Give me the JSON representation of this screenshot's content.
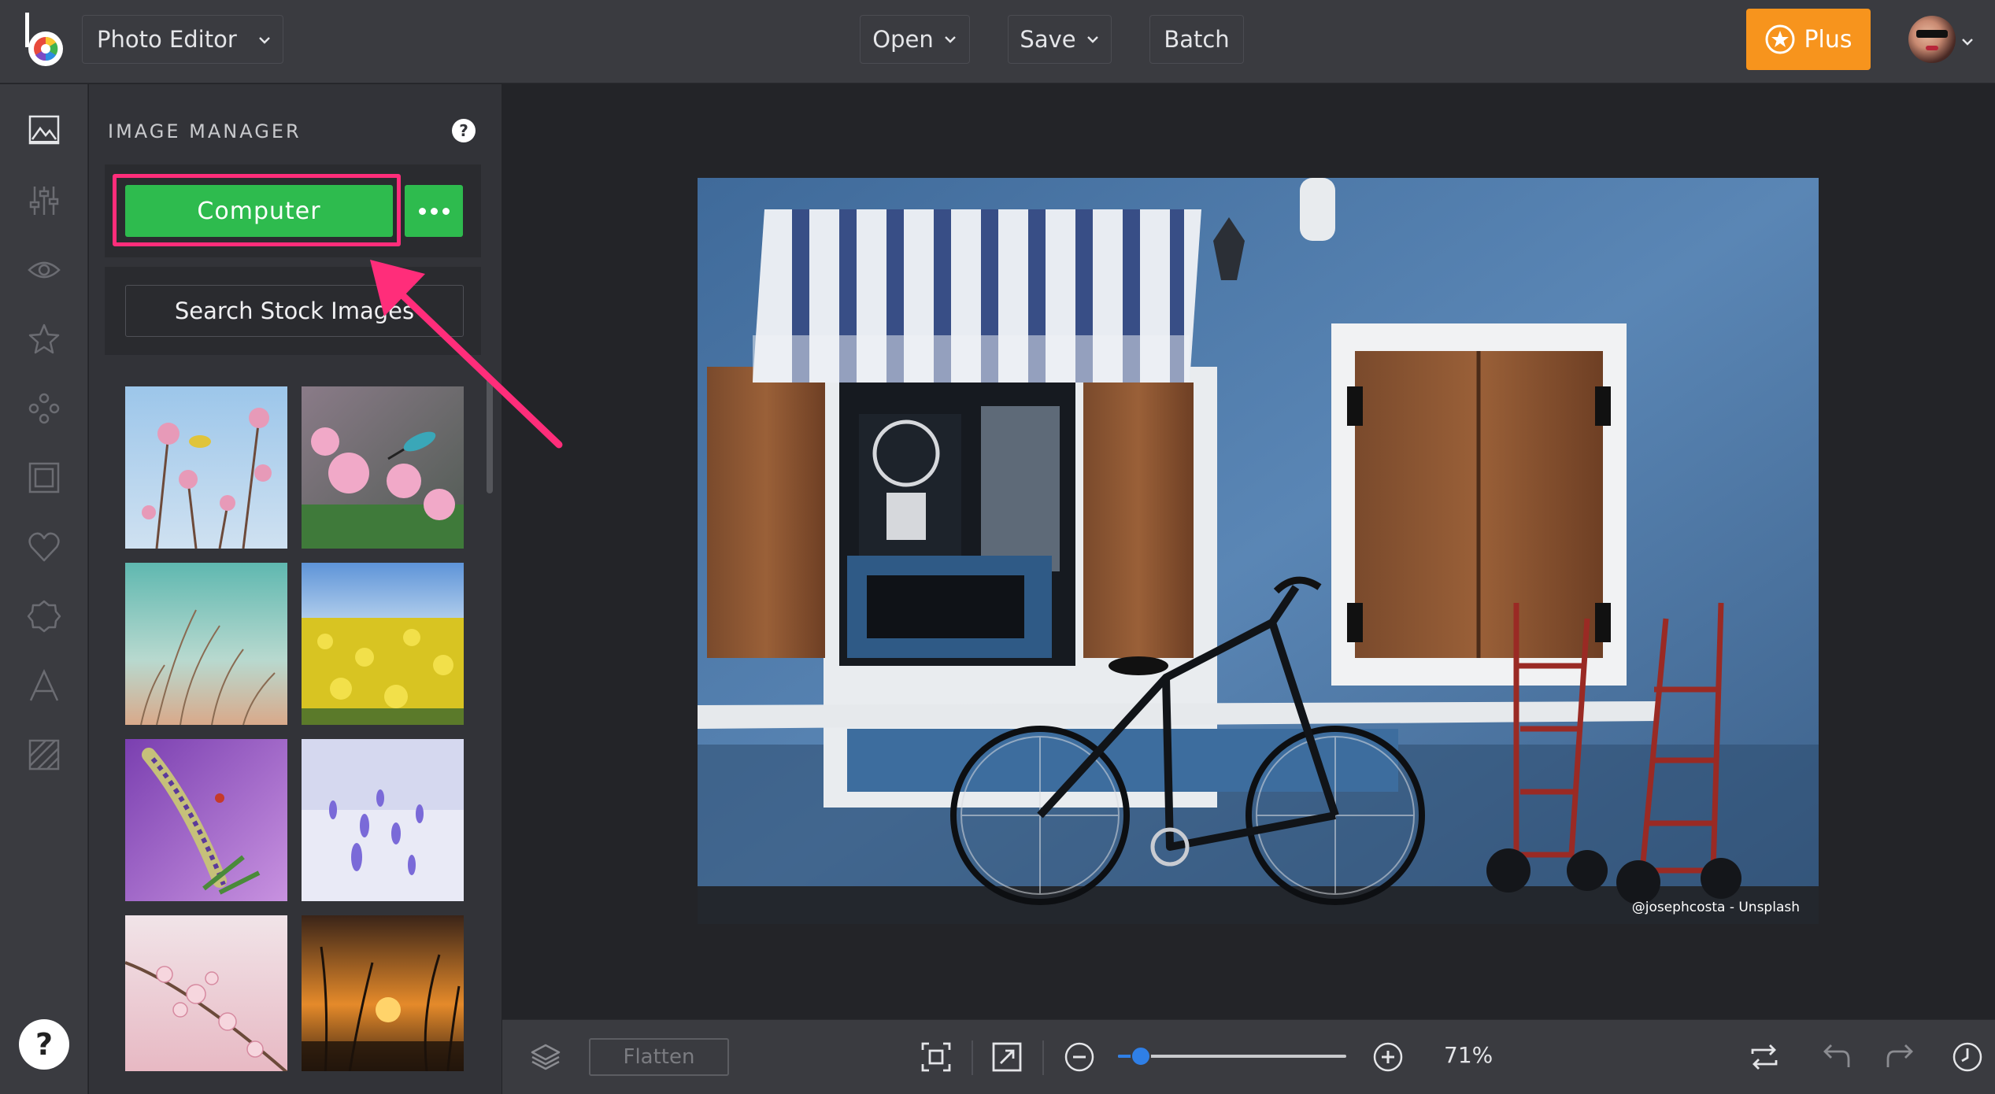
{
  "topbar": {
    "app_name": "Photo Editor",
    "open_label": "Open",
    "save_label": "Save",
    "batch_label": "Batch",
    "plus_label": "Plus"
  },
  "rail": {
    "icons": [
      "image-icon",
      "sliders-icon",
      "eye-icon",
      "star-icon",
      "shapes-icon",
      "frame-icon",
      "heart-icon",
      "badge-icon",
      "text-icon",
      "texture-icon"
    ],
    "help_label": "?"
  },
  "panel": {
    "title": "IMAGE MANAGER",
    "help_label": "?",
    "computer_label": "Computer",
    "stock_label": "Search Stock Images",
    "thumbnails": [
      "flowers-bee",
      "hummingbird-flowers",
      "grass-teal",
      "yellow-field",
      "purple-lupine",
      "snow-crocus",
      "blossom-branch",
      "sunset-grass"
    ]
  },
  "canvas": {
    "credit": "@josephcosta - Unsplash"
  },
  "bottombar": {
    "flatten_label": "Flatten",
    "zoom_value": 71,
    "zoom_label": "71%"
  },
  "colors": {
    "accent_green": "#2ebb4e",
    "plus_orange": "#f7941d",
    "highlight_pink": "#ff2d7a",
    "zoom_blue": "#2f7fe6"
  }
}
